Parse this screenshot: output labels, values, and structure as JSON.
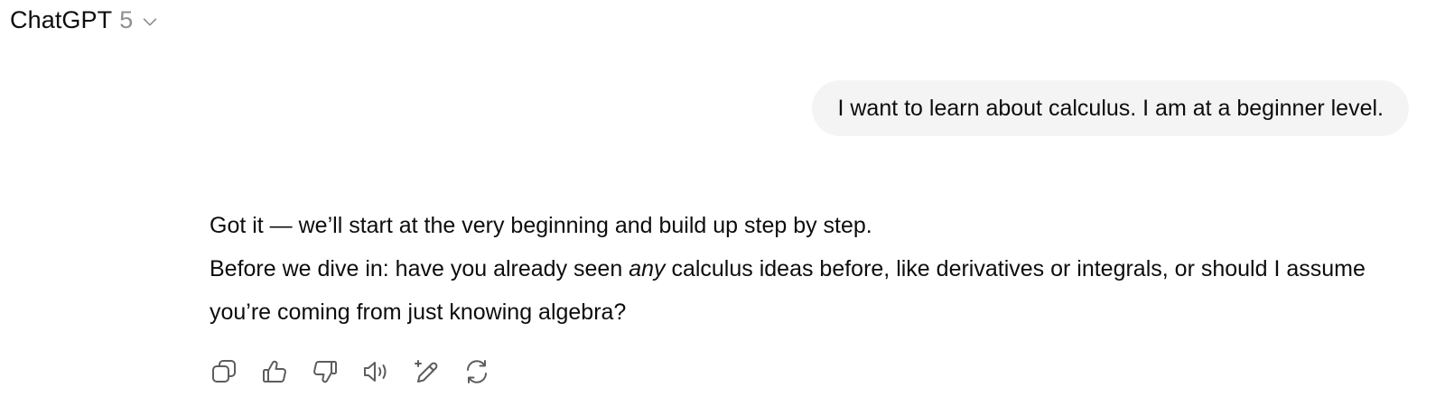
{
  "header": {
    "model_name": "ChatGPT",
    "model_version": "5",
    "selector_icon": "chevron-down-icon"
  },
  "conversation": {
    "user_message": "I want to learn about calculus. I am at a beginner level.",
    "assistant": {
      "line1": "Got it — we’ll start at the very beginning and build up step by step.",
      "line2_before": "Before we dive in: have you already seen ",
      "line2_emphasis": "any",
      "line2_after": " calculus ideas before, like derivatives or integrals, or should I assume you’re coming from just knowing algebra?"
    }
  },
  "actions": [
    {
      "icon": "copy-icon"
    },
    {
      "icon": "thumbs-up-icon"
    },
    {
      "icon": "thumbs-down-icon"
    },
    {
      "icon": "read-aloud-icon"
    },
    {
      "icon": "edit-canvas-icon"
    },
    {
      "icon": "regenerate-icon"
    }
  ],
  "colors": {
    "text": "#0d0d0d",
    "muted": "#8f8f8f",
    "bubble_bg": "#f4f4f4",
    "icon": "#5d5d5d"
  }
}
